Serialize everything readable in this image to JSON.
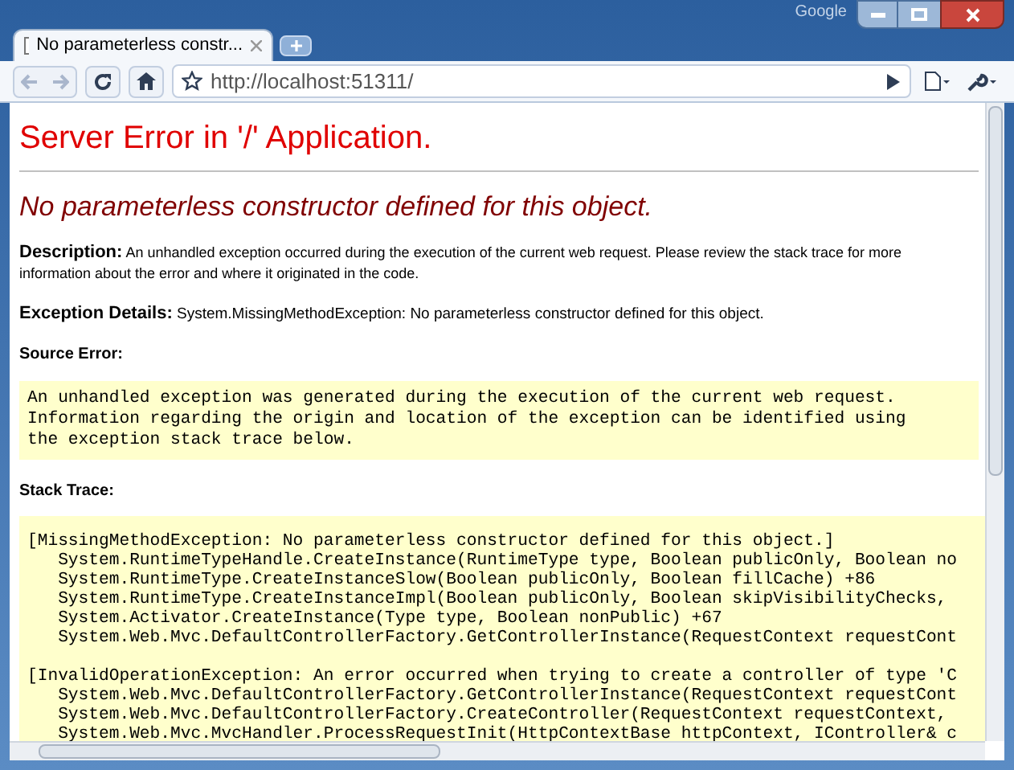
{
  "window": {
    "brand": "Google"
  },
  "tabs": [
    {
      "title": "No parameterless constr...",
      "selected": true
    }
  ],
  "toolbar": {
    "address": "http://localhost:51311/"
  },
  "page": {
    "heading": "Server Error in '/' Application.",
    "error_title": "No parameterless constructor defined for this object.",
    "description": {
      "label": "Description:",
      "text": "An unhandled exception occurred during the execution of the current web request. Please review the stack trace for more information about the error and where it originated in the code."
    },
    "exception_details": {
      "label": "Exception Details:",
      "text": "System.MissingMethodException: No parameterless constructor defined for this object."
    },
    "source_error": {
      "label": "Source Error:",
      "lines": [
        "An unhandled exception was generated during the execution of the current web request.",
        "Information regarding the origin and location of the exception can be identified using",
        "the exception stack trace below."
      ]
    },
    "stack_trace": {
      "label": "Stack Trace:",
      "blocks": [
        [
          "[MissingMethodException: No parameterless constructor defined for this object.]",
          "   System.RuntimeTypeHandle.CreateInstance(RuntimeType type, Boolean publicOnly, Boolean no",
          "   System.RuntimeType.CreateInstanceSlow(Boolean publicOnly, Boolean fillCache) +86",
          "   System.RuntimeType.CreateInstanceImpl(Boolean publicOnly, Boolean skipVisibilityChecks,",
          "   System.Activator.CreateInstance(Type type, Boolean nonPublic) +67",
          "   System.Web.Mvc.DefaultControllerFactory.GetControllerInstance(RequestContext requestCont"
        ],
        [
          "[InvalidOperationException: An error occurred when trying to create a controller of type 'C",
          "   System.Web.Mvc.DefaultControllerFactory.GetControllerInstance(RequestContext requestCont",
          "   System.Web.Mvc.DefaultControllerFactory.CreateController(RequestContext requestContext,",
          "   System.Web.Mvc.MvcHandler.ProcessRequestInit(HttpContextBase httpContext, IController& c"
        ]
      ]
    }
  }
}
